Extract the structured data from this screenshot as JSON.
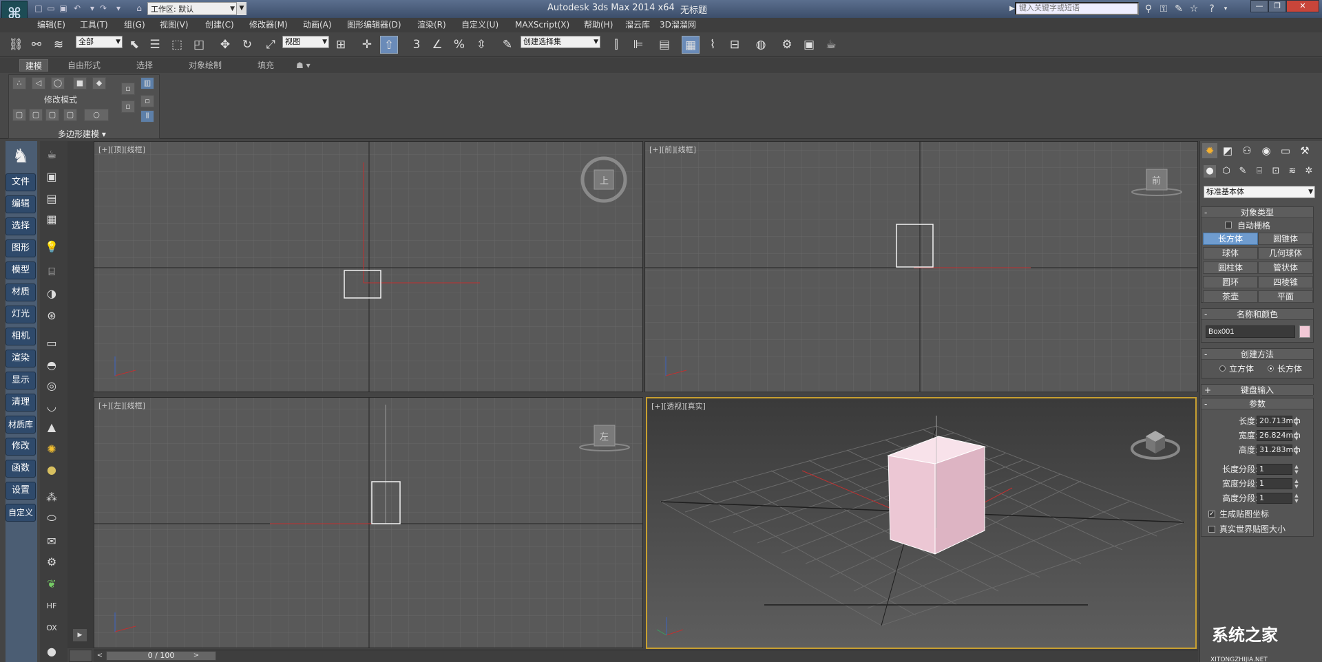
{
  "window": {
    "workspace": "工作区: 默认",
    "title_app": "Autodesk 3ds Max  2014 x64",
    "title_doc": "无标题",
    "search_placeholder": "键入关键字或短语"
  },
  "menu": [
    "编辑(E)",
    "工具(T)",
    "组(G)",
    "视图(V)",
    "创建(C)",
    "修改器(M)",
    "动画(A)",
    "图形编辑器(D)",
    "渲染(R)",
    "自定义(U)",
    "MAXScript(X)",
    "帮助(H)",
    "溜云库",
    "3D溜溜网"
  ],
  "toolbar": {
    "filter_select": "全部",
    "view_select": "视图",
    "named_selection": "创建选择集",
    "snap_label": "3",
    "angle_snap": "%"
  },
  "ribbon": {
    "tabs": [
      "建模",
      "自由形式",
      "选择",
      "对象绘制",
      "填充"
    ],
    "active_tab": "建模",
    "mode_label": "修改模式",
    "panel_label": "多边形建模 ▾"
  },
  "command_list": [
    "文件",
    "编辑",
    "选择",
    "图形",
    "模型",
    "材质",
    "灯光",
    "相机",
    "渲染",
    "显示",
    "清理",
    "材质库",
    "修改",
    "函数",
    "设置",
    "自定义"
  ],
  "viewports": {
    "top": {
      "label": "[+][顶][线框]",
      "cube": "上"
    },
    "front": {
      "label": "[+][前][线框]",
      "cube": "前"
    },
    "left": {
      "label": "[+][左][线框]",
      "cube": "左"
    },
    "persp": {
      "label": "[+][透视][真实]"
    }
  },
  "cmdpanel": {
    "category_select": "标准基本体",
    "object_type": {
      "title": "对象类型",
      "autogrid": "自动栅格",
      "buttons": [
        "长方体",
        "圆锥体",
        "球体",
        "几何球体",
        "圆柱体",
        "管状体",
        "圆环",
        "四棱锥",
        "茶壶",
        "平面"
      ],
      "active": "长方体"
    },
    "name_color": {
      "title": "名称和颜色",
      "name": "Box001",
      "color": "#f2c8d6"
    },
    "creation": {
      "title": "创建方法",
      "opt1": "立方体",
      "opt2": "长方体",
      "selected": "长方体"
    },
    "keyboard": {
      "title": "键盘输入"
    },
    "params": {
      "title": "参数",
      "length_label": "长度:",
      "length": "20.713mm",
      "width_label": "宽度:",
      "width": "26.824mm",
      "height_label": "高度:",
      "height": "31.283mm",
      "lseg_label": "长度分段:",
      "lseg": "1",
      "wseg_label": "宽度分段:",
      "wseg": "1",
      "hseg_label": "高度分段:",
      "hseg": "1",
      "gen_map": "生成贴图坐标",
      "real_world": "真实世界贴图大小"
    }
  },
  "timeline": {
    "slider": "0 / 100"
  },
  "watermark": {
    "brand": "系统之家",
    "url": "XITONGZHIJIA.NET"
  },
  "colors": {
    "box": "#f2c8d6",
    "grid_axis": "#c03030",
    "active_border": "#c8a030"
  }
}
